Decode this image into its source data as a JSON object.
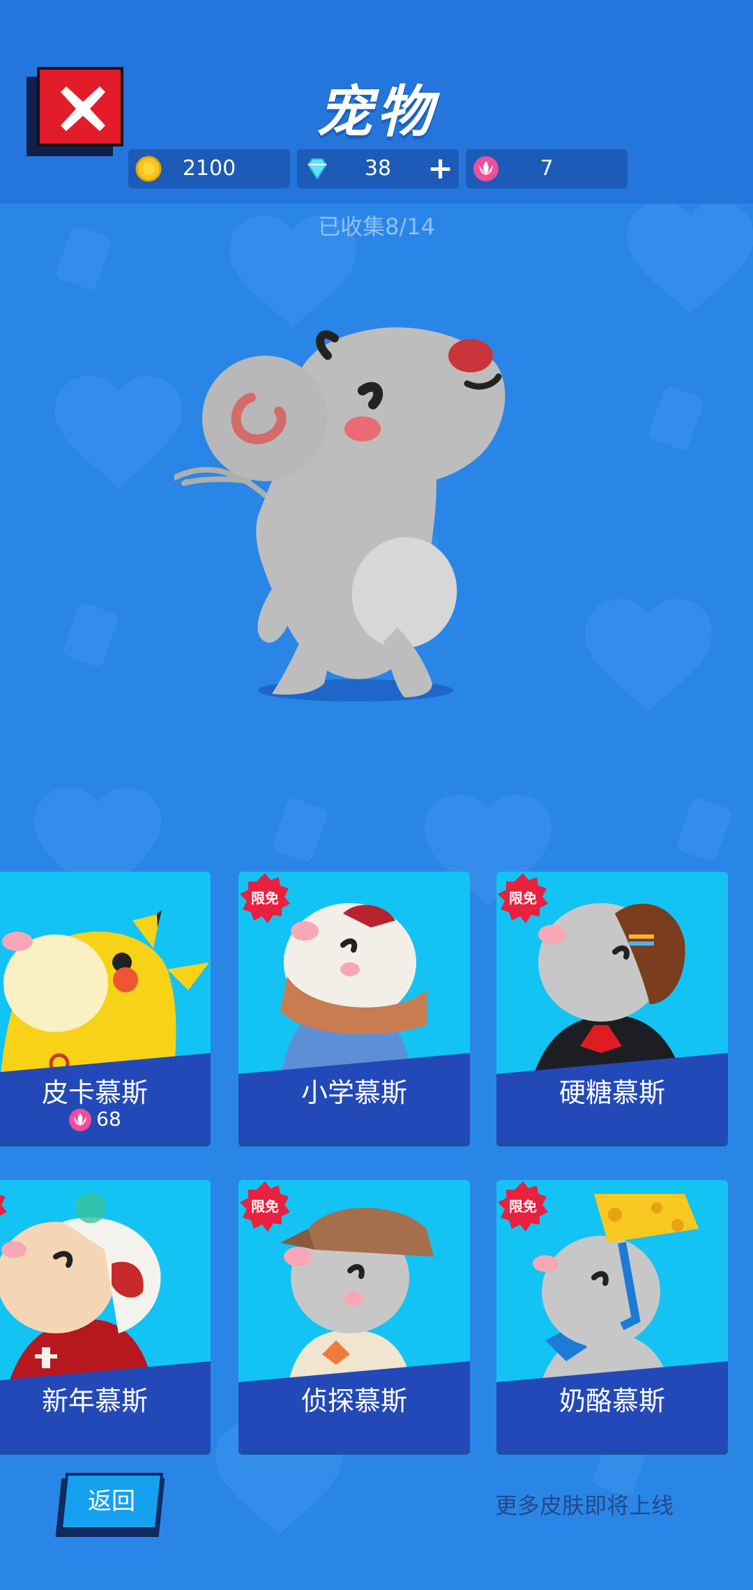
{
  "header": {
    "title": "宠物",
    "close_icon": "close-icon"
  },
  "currencies": [
    {
      "icon": "gold-coin-icon",
      "value": "2100",
      "has_plus": false
    },
    {
      "icon": "diamond-icon",
      "value": "38",
      "has_plus": true
    },
    {
      "icon": "lotus-icon",
      "value": "7",
      "has_plus": false
    }
  ],
  "collection": {
    "label": "已收集8/14"
  },
  "pets": [
    {
      "name": "皮卡慕斯",
      "badge": "",
      "price": "68",
      "price_icon": "lotus-icon"
    },
    {
      "name": "小学慕斯",
      "badge": "限免",
      "price": ""
    },
    {
      "name": "硬糖慕斯",
      "badge": "限免",
      "price": ""
    },
    {
      "name": "新年慕斯",
      "badge": "限免",
      "price": ""
    },
    {
      "name": "侦探慕斯",
      "badge": "限免",
      "price": ""
    },
    {
      "name": "奶酪慕斯",
      "badge": "限免",
      "price": ""
    }
  ],
  "footer": {
    "back_label": "返回",
    "more_text": "更多皮肤即将上线"
  },
  "colors": {
    "background": "#2a86e6",
    "header": "#2475dc",
    "card": "#13c3f4",
    "card_band": "#2349b8",
    "badge": "#e8213f",
    "close_button": "#e31c2a"
  }
}
